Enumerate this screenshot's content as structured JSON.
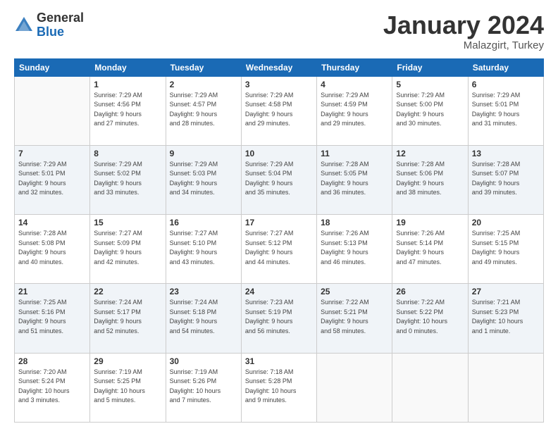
{
  "logo": {
    "general": "General",
    "blue": "Blue"
  },
  "header": {
    "month": "January 2024",
    "location": "Malazgirt, Turkey"
  },
  "weekdays": [
    "Sunday",
    "Monday",
    "Tuesday",
    "Wednesday",
    "Thursday",
    "Friday",
    "Saturday"
  ],
  "weeks": [
    [
      {
        "day": null
      },
      {
        "day": "1",
        "sunrise": "7:29 AM",
        "sunset": "4:56 PM",
        "daylight": "9 hours and 27 minutes."
      },
      {
        "day": "2",
        "sunrise": "7:29 AM",
        "sunset": "4:57 PM",
        "daylight": "9 hours and 28 minutes."
      },
      {
        "day": "3",
        "sunrise": "7:29 AM",
        "sunset": "4:58 PM",
        "daylight": "9 hours and 29 minutes."
      },
      {
        "day": "4",
        "sunrise": "7:29 AM",
        "sunset": "4:59 PM",
        "daylight": "9 hours and 29 minutes."
      },
      {
        "day": "5",
        "sunrise": "7:29 AM",
        "sunset": "5:00 PM",
        "daylight": "9 hours and 30 minutes."
      },
      {
        "day": "6",
        "sunrise": "7:29 AM",
        "sunset": "5:01 PM",
        "daylight": "9 hours and 31 minutes."
      }
    ],
    [
      {
        "day": "7",
        "sunrise": "7:29 AM",
        "sunset": "5:01 PM",
        "daylight": "9 hours and 32 minutes."
      },
      {
        "day": "8",
        "sunrise": "7:29 AM",
        "sunset": "5:02 PM",
        "daylight": "9 hours and 33 minutes."
      },
      {
        "day": "9",
        "sunrise": "7:29 AM",
        "sunset": "5:03 PM",
        "daylight": "9 hours and 34 minutes."
      },
      {
        "day": "10",
        "sunrise": "7:29 AM",
        "sunset": "5:04 PM",
        "daylight": "9 hours and 35 minutes."
      },
      {
        "day": "11",
        "sunrise": "7:28 AM",
        "sunset": "5:05 PM",
        "daylight": "9 hours and 36 minutes."
      },
      {
        "day": "12",
        "sunrise": "7:28 AM",
        "sunset": "5:06 PM",
        "daylight": "9 hours and 38 minutes."
      },
      {
        "day": "13",
        "sunrise": "7:28 AM",
        "sunset": "5:07 PM",
        "daylight": "9 hours and 39 minutes."
      }
    ],
    [
      {
        "day": "14",
        "sunrise": "7:28 AM",
        "sunset": "5:08 PM",
        "daylight": "9 hours and 40 minutes."
      },
      {
        "day": "15",
        "sunrise": "7:27 AM",
        "sunset": "5:09 PM",
        "daylight": "9 hours and 42 minutes."
      },
      {
        "day": "16",
        "sunrise": "7:27 AM",
        "sunset": "5:10 PM",
        "daylight": "9 hours and 43 minutes."
      },
      {
        "day": "17",
        "sunrise": "7:27 AM",
        "sunset": "5:12 PM",
        "daylight": "9 hours and 44 minutes."
      },
      {
        "day": "18",
        "sunrise": "7:26 AM",
        "sunset": "5:13 PM",
        "daylight": "9 hours and 46 minutes."
      },
      {
        "day": "19",
        "sunrise": "7:26 AM",
        "sunset": "5:14 PM",
        "daylight": "9 hours and 47 minutes."
      },
      {
        "day": "20",
        "sunrise": "7:25 AM",
        "sunset": "5:15 PM",
        "daylight": "9 hours and 49 minutes."
      }
    ],
    [
      {
        "day": "21",
        "sunrise": "7:25 AM",
        "sunset": "5:16 PM",
        "daylight": "9 hours and 51 minutes."
      },
      {
        "day": "22",
        "sunrise": "7:24 AM",
        "sunset": "5:17 PM",
        "daylight": "9 hours and 52 minutes."
      },
      {
        "day": "23",
        "sunrise": "7:24 AM",
        "sunset": "5:18 PM",
        "daylight": "9 hours and 54 minutes."
      },
      {
        "day": "24",
        "sunrise": "7:23 AM",
        "sunset": "5:19 PM",
        "daylight": "9 hours and 56 minutes."
      },
      {
        "day": "25",
        "sunrise": "7:22 AM",
        "sunset": "5:21 PM",
        "daylight": "9 hours and 58 minutes."
      },
      {
        "day": "26",
        "sunrise": "7:22 AM",
        "sunset": "5:22 PM",
        "daylight": "10 hours and 0 minutes."
      },
      {
        "day": "27",
        "sunrise": "7:21 AM",
        "sunset": "5:23 PM",
        "daylight": "10 hours and 1 minute."
      }
    ],
    [
      {
        "day": "28",
        "sunrise": "7:20 AM",
        "sunset": "5:24 PM",
        "daylight": "10 hours and 3 minutes."
      },
      {
        "day": "29",
        "sunrise": "7:19 AM",
        "sunset": "5:25 PM",
        "daylight": "10 hours and 5 minutes."
      },
      {
        "day": "30",
        "sunrise": "7:19 AM",
        "sunset": "5:26 PM",
        "daylight": "10 hours and 7 minutes."
      },
      {
        "day": "31",
        "sunrise": "7:18 AM",
        "sunset": "5:28 PM",
        "daylight": "10 hours and 9 minutes."
      },
      {
        "day": null
      },
      {
        "day": null
      },
      {
        "day": null
      }
    ]
  ]
}
